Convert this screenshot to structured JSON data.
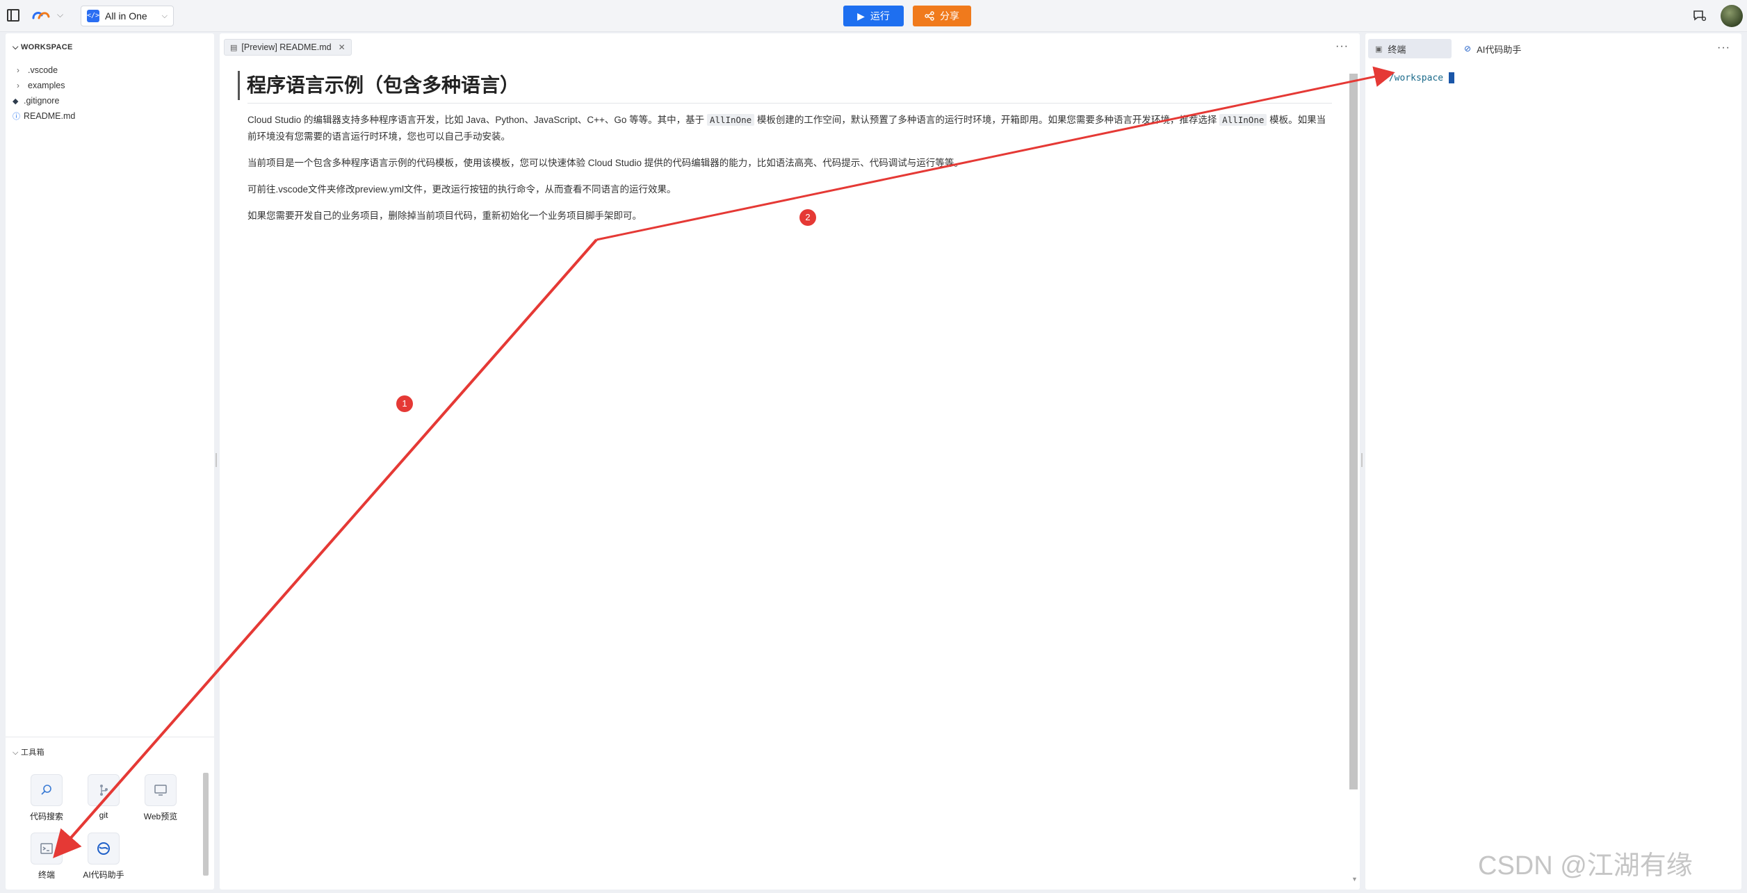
{
  "topbar": {
    "workspace_name": "All in One",
    "run_label": "运行",
    "share_label": "分享"
  },
  "sidebar": {
    "section_title": "WORKSPACE",
    "tree": [
      {
        "label": ".vscode",
        "kind": "folder"
      },
      {
        "label": "examples",
        "kind": "folder"
      },
      {
        "label": ".gitignore",
        "kind": "git-file"
      },
      {
        "label": "README.md",
        "kind": "info-file"
      }
    ],
    "toolbox_title": "工具箱",
    "tools": [
      {
        "label": "代码搜索",
        "icon": "search-icon"
      },
      {
        "label": "git",
        "icon": "git-icon"
      },
      {
        "label": "Web预览",
        "icon": "monitor-icon"
      },
      {
        "label": "终端",
        "icon": "terminal-icon"
      },
      {
        "label": "AI代码助手",
        "icon": "ai-assistant-icon"
      }
    ]
  },
  "editor": {
    "tab_label": "[Preview] README.md",
    "doc_title": "程序语言示例（包含多种语言）",
    "p1_a": "Cloud Studio 的编辑器支持多种程序语言开发，比如 Java、Python、JavaScript、C++、Go 等等。其中，基于",
    "p1_code1": "AllInOne",
    "p1_b": "模板创建的工作空间，默认预置了多种语言的运行时环境，开箱即用。如果您需要多种语言开发环境，推荐选择",
    "p1_code2": "AllInOne",
    "p1_c": "模板。如果当前环境没有您需要的语言运行时环境，您也可以自己手动安装。",
    "p2": "当前项目是一个包含多种程序语言示例的代码模板，使用该模板，您可以快速体验 Cloud Studio 提供的代码编辑器的能力，比如语法高亮、代码提示、代码调试与运行等等。",
    "p3": "可前往.vscode文件夹修改preview.yml文件，更改运行按钮的执行命令，从而查看不同语言的运行效果。",
    "p4": "如果您需要开发自己的业务项目，删除掉当前项目代码，重新初始化一个业务项目脚手架即可。"
  },
  "right_panel": {
    "tabs": [
      {
        "label": "终端",
        "active": true
      },
      {
        "label": "AI代码助手",
        "active": false
      }
    ],
    "terminal_prompt": "/workspace"
  },
  "annotations": {
    "badge_1": "1",
    "badge_2": "2",
    "color": "#e53935"
  },
  "watermark": "CSDN @江湖有缘",
  "colors": {
    "run": "#1e6ff0",
    "share": "#f07a1c",
    "accent": "#1e6ff0"
  }
}
